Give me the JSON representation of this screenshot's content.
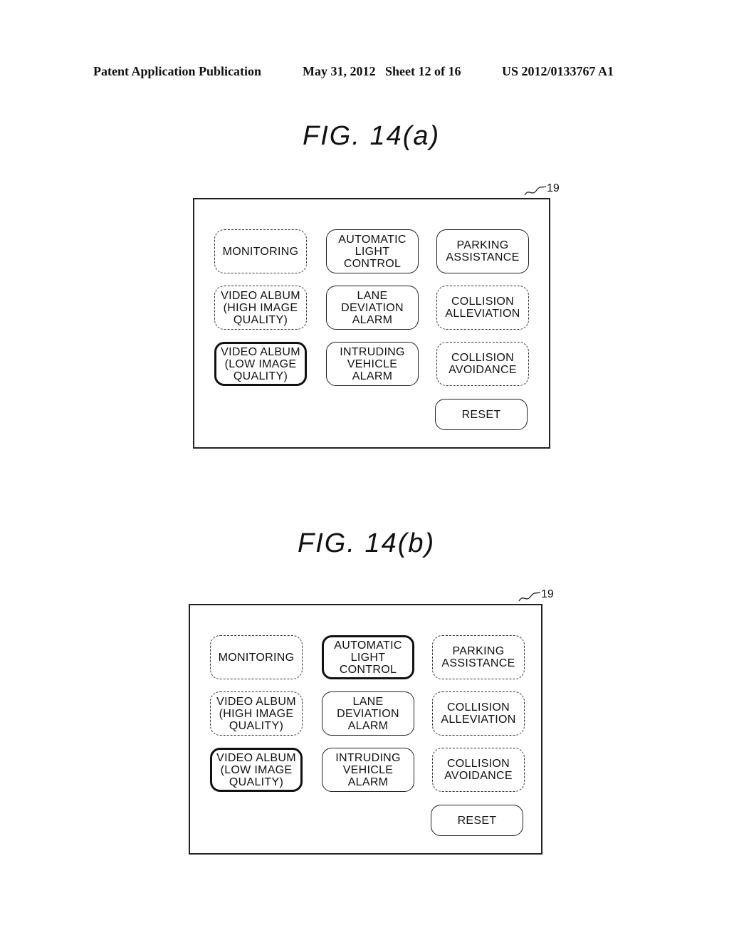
{
  "header": {
    "publication": "Patent Application Publication",
    "date_sheet": "May 31, 2012   Sheet 12 of 16",
    "number": "US 2012/0133767 A1"
  },
  "figures": [
    {
      "title": "FIG. 14(a)",
      "ref_label": "19",
      "buttons": [
        {
          "label": "MONITORING",
          "state": "dashed"
        },
        {
          "label": "AUTOMATIC\nLIGHT\nCONTROL",
          "state": "solid"
        },
        {
          "label": "PARKING\nASSISTANCE",
          "state": "solid"
        },
        {
          "label": "VIDEO  ALBUM\n(HIGH  IMAGE\nQUALITY)",
          "state": "dashed"
        },
        {
          "label": "LANE\nDEVIATION\nALARM",
          "state": "solid"
        },
        {
          "label": "COLLISION\nALLEVIATION",
          "state": "dashed"
        },
        {
          "label": "VIDEO  ALBUM\n(LOW  IMAGE\nQUALITY)",
          "state": "selected"
        },
        {
          "label": "INTRUDING\nVEHICLE\nALARM",
          "state": "solid"
        },
        {
          "label": "COLLISION\nAVOIDANCE",
          "state": "dashed"
        }
      ],
      "reset_label": "RESET"
    },
    {
      "title": "FIG. 14(b)",
      "ref_label": "19",
      "buttons": [
        {
          "label": "MONITORING",
          "state": "dashed"
        },
        {
          "label": "AUTOMATIC\nLIGHT\nCONTROL",
          "state": "selected"
        },
        {
          "label": "PARKING\nASSISTANCE",
          "state": "dashed"
        },
        {
          "label": "VIDEO  ALBUM\n(HIGH  IMAGE\nQUALITY)",
          "state": "dashed"
        },
        {
          "label": "LANE\nDEVIATION\nALARM",
          "state": "solid"
        },
        {
          "label": "COLLISION\nALLEVIATION",
          "state": "dashed"
        },
        {
          "label": "VIDEO  ALBUM\n(LOW  IMAGE\nQUALITY)",
          "state": "selected"
        },
        {
          "label": "INTRUDING\nVEHICLE\nALARM",
          "state": "solid"
        },
        {
          "label": "COLLISION\nAVOIDANCE",
          "state": "dashed"
        }
      ],
      "reset_label": "RESET"
    }
  ]
}
